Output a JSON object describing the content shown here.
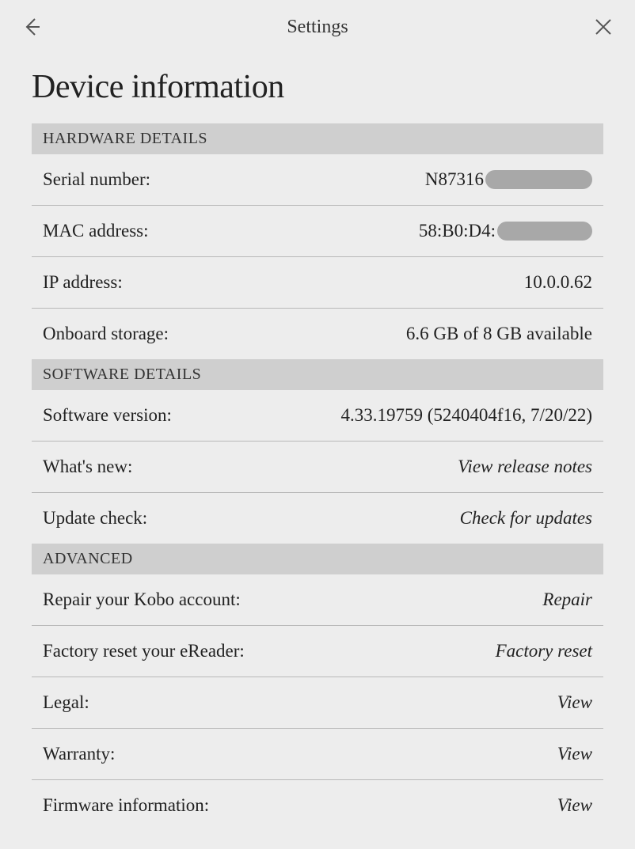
{
  "header": {
    "title": "Settings"
  },
  "page": {
    "title": "Device information"
  },
  "sections": {
    "hardware": {
      "title": "HARDWARE DETAILS",
      "serial_label": "Serial number:",
      "serial_value_visible": "N87316",
      "mac_label": "MAC address:",
      "mac_value_visible": "58:B0:D4:",
      "ip_label": "IP address:",
      "ip_value": "10.0.0.62",
      "storage_label": "Onboard storage:",
      "storage_value": "6.6 GB of 8 GB available"
    },
    "software": {
      "title": "SOFTWARE DETAILS",
      "version_label": "Software version:",
      "version_value": "4.33.19759 (5240404f16, 7/20/22)",
      "whatsnew_label": "What's new:",
      "whatsnew_action": "View release notes",
      "update_label": "Update check:",
      "update_action": "Check for updates"
    },
    "advanced": {
      "title": "ADVANCED",
      "repair_label": "Repair your Kobo account:",
      "repair_action": "Repair",
      "reset_label": "Factory reset your eReader:",
      "reset_action": "Factory reset",
      "legal_label": "Legal:",
      "legal_action": "View",
      "warranty_label": "Warranty:",
      "warranty_action": "View",
      "firmware_label": "Firmware information:",
      "firmware_action": "View"
    }
  }
}
